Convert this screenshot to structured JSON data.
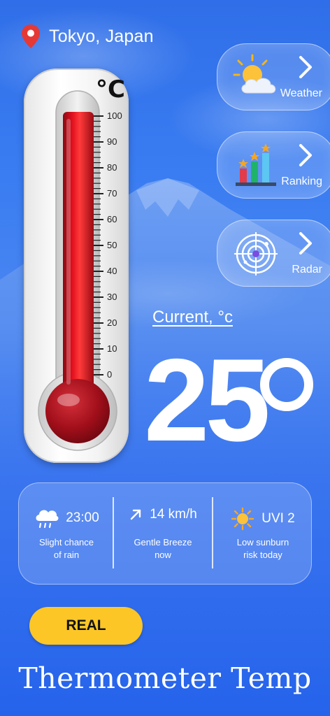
{
  "location": {
    "text": "Tokyo, Japan",
    "icon": "map-pin-icon",
    "pin_color": "#e53935"
  },
  "thermometer": {
    "unit": "°C",
    "scale": [
      "100",
      "90",
      "80",
      "70",
      "60",
      "50",
      "40",
      "30",
      "20",
      "10",
      "0"
    ],
    "fill_value": 100,
    "fill_color": "#c8101e"
  },
  "side_buttons": [
    {
      "label": "Weather",
      "icon": "sun-cloud-icon"
    },
    {
      "label": "Ranking",
      "icon": "ranking-bars-icon"
    },
    {
      "label": "Radar",
      "icon": "radar-icon"
    }
  ],
  "current": {
    "label": "Current, °c",
    "value": "25"
  },
  "info": [
    {
      "icon": "rain-cloud-icon",
      "value": "23:00",
      "desc_line1": "Slight chance",
      "desc_line2": "of rain"
    },
    {
      "icon": "arrow-up-right-icon",
      "value": "14 km/h",
      "desc_line1": "Gentle Breeze",
      "desc_line2": "now"
    },
    {
      "icon": "sun-icon",
      "value": "UVI 2",
      "desc_line1": "Low sunburn",
      "desc_line2": "risk today"
    }
  ],
  "real_button": {
    "label": "REAL",
    "color": "#fcc626"
  },
  "app_title": "Thermometer Temp"
}
